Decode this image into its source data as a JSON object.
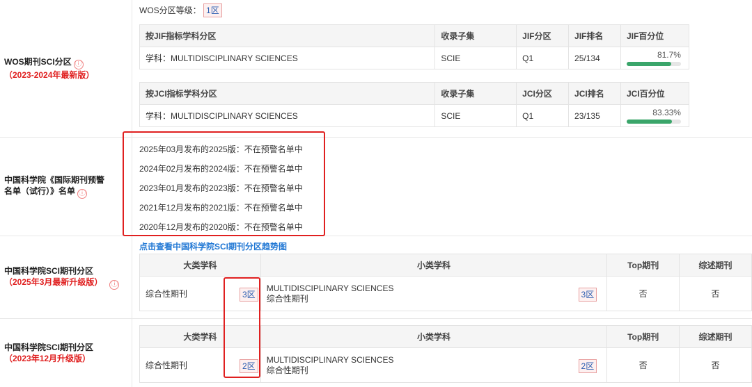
{
  "wos": {
    "label_title": "WOS期刊SCI分区",
    "label_sub": "（2023-2024年最新版）",
    "level_label": "WOS分区等级：",
    "level_value": "1区",
    "jif_headers": [
      "按JIF指标学科分区",
      "收录子集",
      "JIF分区",
      "JIF排名",
      "JIF百分位"
    ],
    "jif_row": {
      "subject": "学科：MULTIDISCIPLINARY SCIENCES",
      "subset": "SCIE",
      "zone": "Q1",
      "rank": "25/134",
      "percentile": "81.7%",
      "percentile_value": 81.7
    },
    "jci_headers": [
      "按JCI指标学科分区",
      "收录子集",
      "JCI分区",
      "JCI排名",
      "JCI百分位"
    ],
    "jci_row": {
      "subject": "学科：MULTIDISCIPLINARY SCIENCES",
      "subset": "SCIE",
      "zone": "Q1",
      "rank": "23/135",
      "percentile": "83.33%",
      "percentile_value": 83.33
    }
  },
  "warning": {
    "label_title_1": "中国科学院《国际期刊预警",
    "label_title_2": "名单（试行）》名单",
    "lines": [
      "2025年03月发布的2025版：不在预警名单中",
      "2024年02月发布的2024版：不在预警名单中",
      "2023年01月发布的2023版：不在预警名单中",
      "2021年12月发布的2021版：不在预警名单中",
      "2020年12月发布的2020版：不在预警名单中"
    ]
  },
  "cas2025": {
    "label_title": "中国科学院SCI期刊分区",
    "label_sub": "（2025年3月最新升级版）",
    "trend_link": "点击查看中国科学院SCI期刊分区趋势图",
    "headers": [
      "大类学科",
      "小类学科",
      "Top期刊",
      "综述期刊"
    ],
    "major": "综合性期刊",
    "major_zone": "3区",
    "minor_en": "MULTIDISCIPLINARY SCIENCES",
    "minor_cn": "综合性期刊",
    "minor_zone": "3区",
    "top": "否",
    "review": "否"
  },
  "cas2023": {
    "label_title": "中国科学院SCI期刊分区",
    "label_sub": "（2023年12月升级版）",
    "headers": [
      "大类学科",
      "小类学科",
      "Top期刊",
      "综述期刊"
    ],
    "major": "综合性期刊",
    "major_zone": "2区",
    "minor_en": "MULTIDISCIPLINARY SCIENCES",
    "minor_cn": "综合性期刊",
    "minor_zone": "2区",
    "top": "否",
    "review": "否"
  },
  "info_icon": "ⓘ",
  "colors": {
    "accent_red": "#e02020",
    "link_blue": "#2077d4",
    "bar_green": "#3aa56a"
  }
}
